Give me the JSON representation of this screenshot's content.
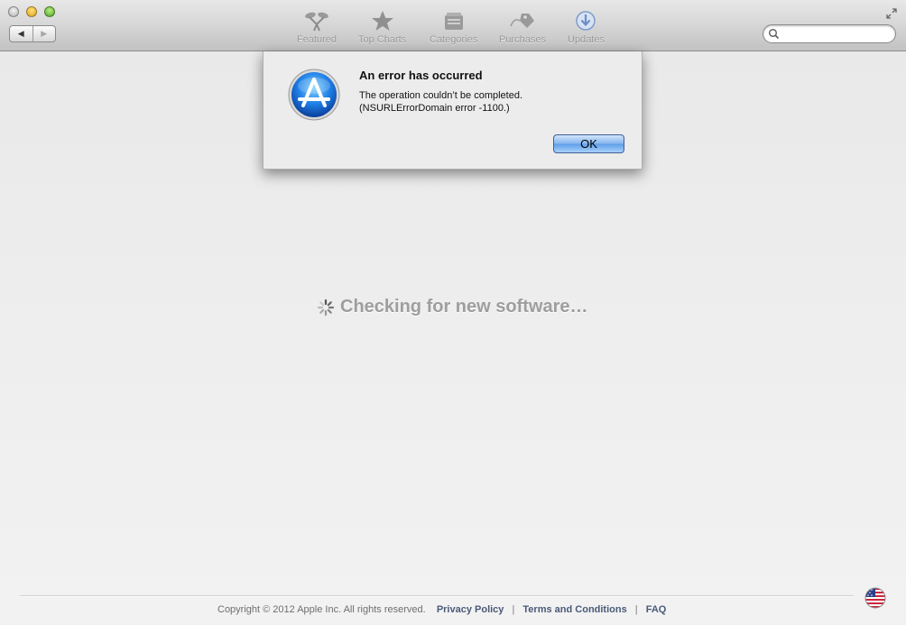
{
  "toolbar": {
    "items": [
      {
        "label": "Featured",
        "icon": "featured-icon"
      },
      {
        "label": "Top Charts",
        "icon": "star-icon"
      },
      {
        "label": "Categories",
        "icon": "categories-icon"
      },
      {
        "label": "Purchases",
        "icon": "price-tag-icon"
      },
      {
        "label": "Updates",
        "icon": "download-arrow-icon"
      }
    ],
    "nav": {
      "back_glyph": "◀",
      "forward_glyph": "▶"
    },
    "search": {
      "placeholder": "",
      "value": ""
    }
  },
  "alert": {
    "title": "An error has occurred",
    "message_line1": "The operation couldn’t be completed.",
    "message_line2": "(NSURLErrorDomain error -1100.)",
    "ok_label": "OK",
    "icon": "app-store-icon"
  },
  "main": {
    "loading_text": "Checking for new software…"
  },
  "footer": {
    "copyright": "Copyright © 2012 Apple Inc. All rights reserved.",
    "links": [
      "Privacy Policy",
      "Terms and Conditions",
      "FAQ"
    ],
    "separator": "|",
    "flag_icon": "us-flag-icon"
  },
  "colors": {
    "ok_button": "#5f9ee9",
    "loading_text": "#9e9e9e",
    "footer_link": "#4a5a78"
  }
}
